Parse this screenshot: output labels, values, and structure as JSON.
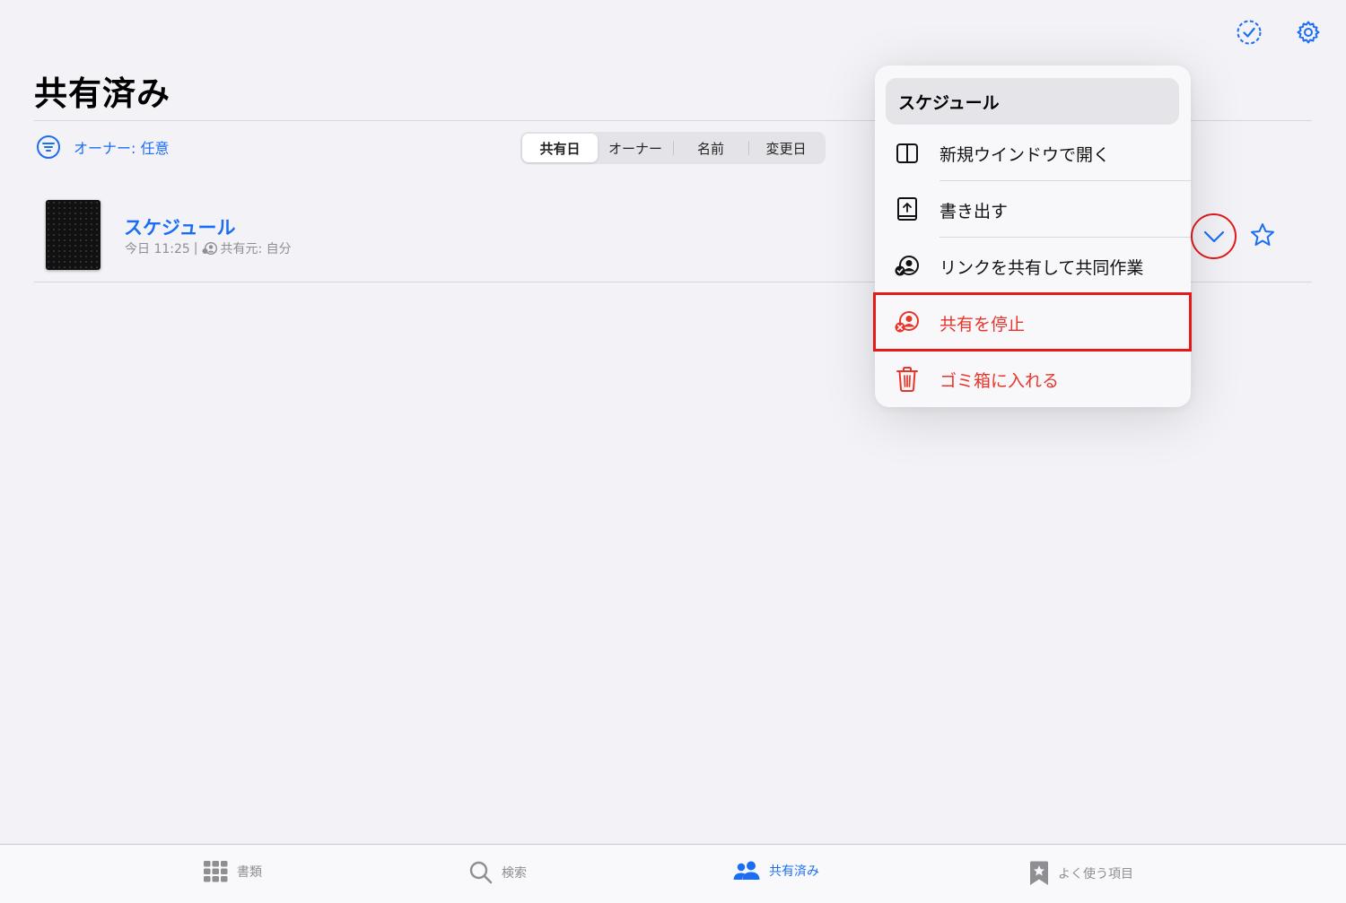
{
  "header": {
    "title": "共有済み",
    "select_icon": "checkmark-circle-dashed-icon",
    "settings_icon": "gear-icon"
  },
  "filter": {
    "label": "オーナー: 任意",
    "icon": "filter-lines-icon"
  },
  "sort_segments": [
    {
      "label": "共有日",
      "selected": true
    },
    {
      "label": "オーナー",
      "selected": false
    },
    {
      "label": "名前",
      "selected": false
    },
    {
      "label": "変更日",
      "selected": false
    }
  ],
  "document": {
    "name": "スケジュール",
    "date": "今日 11:25",
    "separator": "|",
    "shared_by": "共有元: 自分"
  },
  "context_menu": {
    "title": "スケジュール",
    "items": [
      {
        "label": "新規ウインドウで開く",
        "icon": "split-window-icon",
        "destructive": false
      },
      {
        "label": "書き出す",
        "icon": "export-book-icon",
        "destructive": false
      },
      {
        "label": "リンクを共有して共同作業",
        "icon": "collaborate-person-icon",
        "destructive": false
      },
      {
        "label": "共有を停止",
        "icon": "stop-sharing-person-icon",
        "destructive": true
      },
      {
        "label": "ゴミ箱に入れる",
        "icon": "trash-icon",
        "destructive": true
      }
    ]
  },
  "tabs": [
    {
      "label": "書類",
      "icon": "grid-icon",
      "active": false
    },
    {
      "label": "検索",
      "icon": "magnifier-icon",
      "active": false
    },
    {
      "label": "共有済み",
      "icon": "people-icon",
      "active": true
    },
    {
      "label": "よく使う項目",
      "icon": "bookmark-star-icon",
      "active": false
    }
  ],
  "colors": {
    "accent": "#1b6ef3",
    "destructive": "#e8352b",
    "annotation_red": "#e21a1a",
    "background": "#f2f2f7"
  }
}
